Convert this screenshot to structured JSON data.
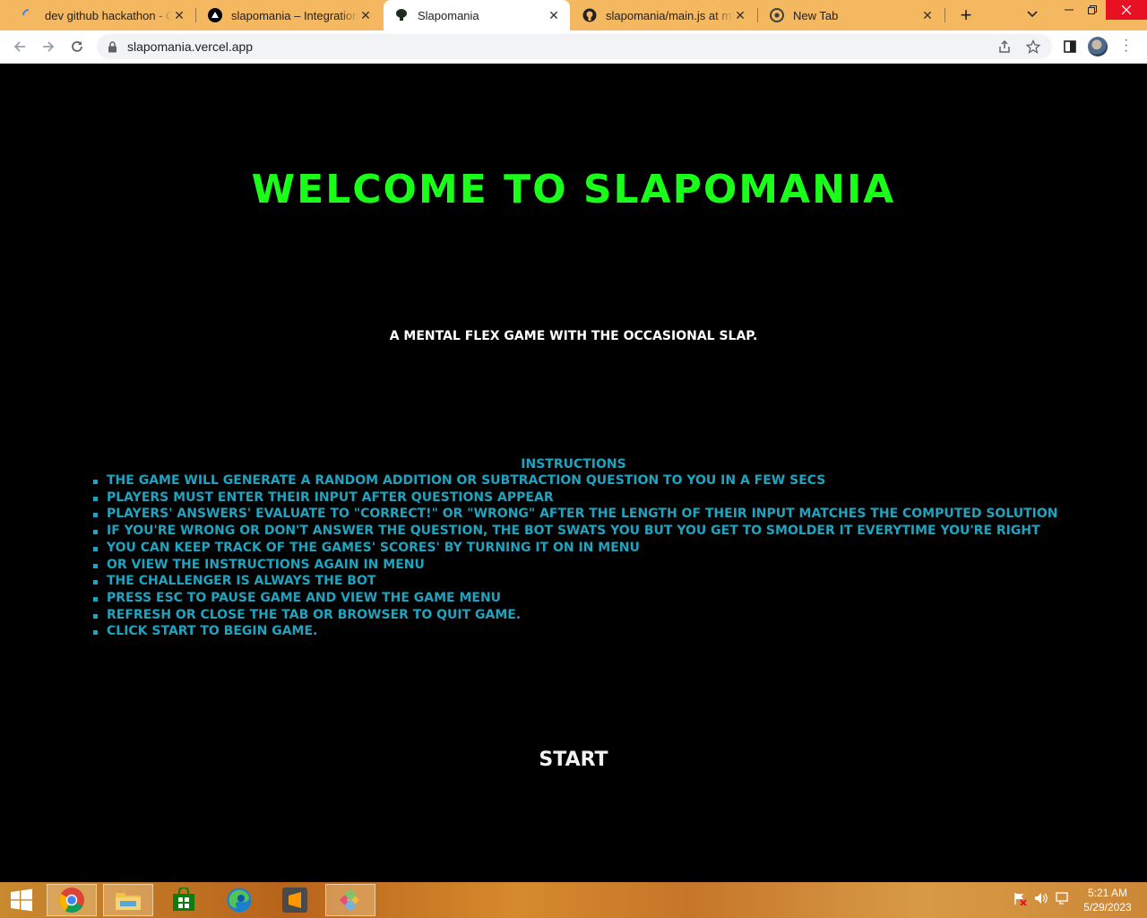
{
  "browser": {
    "tabs": [
      {
        "title": "dev github hackathon - Goo",
        "icon": "loading-spinner-icon",
        "active": false
      },
      {
        "title": "slapomania – Integrations –",
        "icon": "vercel-icon",
        "active": false
      },
      {
        "title": "Slapomania",
        "icon": "slapomania-favicon",
        "active": true
      },
      {
        "title": "slapomania/main.js at main",
        "icon": "github-icon",
        "active": false
      },
      {
        "title": "New Tab",
        "icon": "chrome-icon",
        "active": false
      }
    ],
    "url": "slapomania.vercel.app"
  },
  "page": {
    "title": "Welcome to Slapomania",
    "tagline": "A mental flex game with the occasional slap.",
    "instructions_heading": "Instructions",
    "instructions": [
      "The game will generate a random addition or subtraction question to you in a few secs",
      "Players must enter their input after questions appear",
      "Players' answers' evaluate to \"Correct!\" or \"Wrong\" after the length of their input matches the computed solution",
      "If you're wrong or don't answer the question, the bot swats you but you get to smolder it everytime you're right",
      "You can keep track of the games' scores' by turning it on in menu",
      "Or view the instructions again in menu",
      "The challenger is always the bot",
      "Press ESC to pause game and view the game menu",
      "Refresh or close the tab or browser to quit game.",
      "Click start to begin game."
    ],
    "start_label": "Start",
    "colors": {
      "title": "#1aff1a",
      "instructions": "#1fa3bf",
      "background": "#000000"
    }
  },
  "taskbar": {
    "apps": [
      "start-icon",
      "chrome-icon",
      "file-explorer-icon",
      "store-icon",
      "edge-icon",
      "sublime-text-icon",
      "git-icon"
    ],
    "time": "5:21 AM",
    "date": "5/29/2023"
  }
}
